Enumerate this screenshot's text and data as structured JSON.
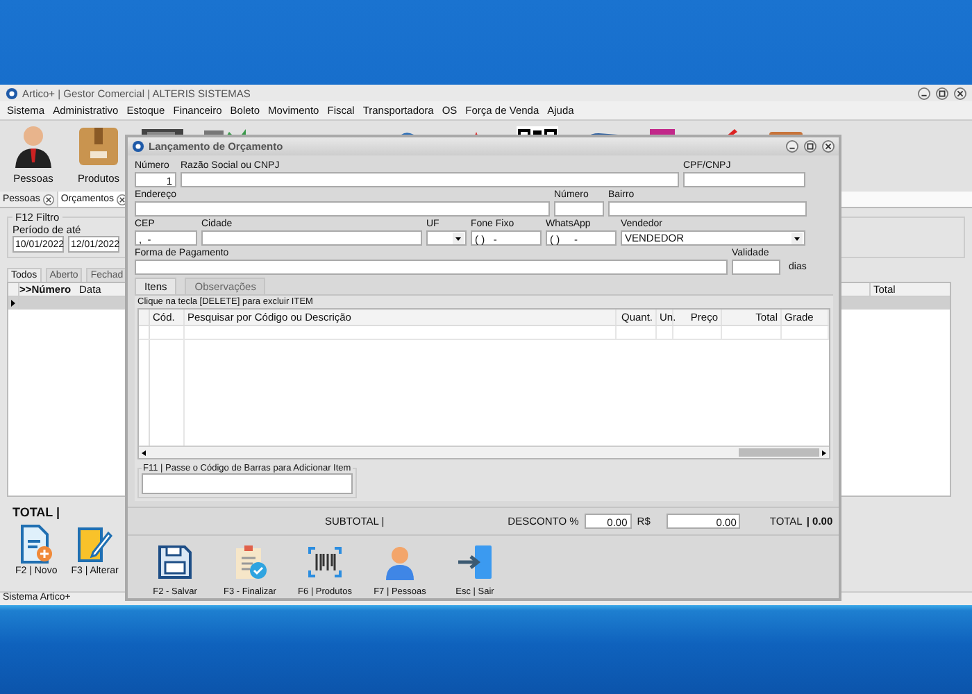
{
  "window": {
    "title": "Artico+ | Gestor Comercial | ALTERIS SISTEMAS"
  },
  "menu": [
    "Sistema",
    "Administrativo",
    "Estoque",
    "Financeiro",
    "Boleto",
    "Movimento",
    "Fiscal",
    "Transportadora",
    "OS",
    "Força de Venda",
    "Ajuda"
  ],
  "toolbar": [
    {
      "label": "Pessoas",
      "kind": "person"
    },
    {
      "label": "Produtos",
      "kind": "box"
    }
  ],
  "doc_tabs": [
    {
      "label": "Pessoas",
      "selected": false
    },
    {
      "label": "Orçamentos",
      "selected": true
    }
  ],
  "filter": {
    "title": "F12 Filtro",
    "period_label": "Período de  até",
    "from": "10/01/2022",
    "to": "12/01/2022"
  },
  "status_tabs": [
    {
      "label": "Todos",
      "selected": true
    },
    {
      "label": "Aberto",
      "selected": false
    },
    {
      "label": "Fechad",
      "selected": false
    }
  ],
  "grid": {
    "columns": [
      ">>Número",
      "Data",
      "Total"
    ]
  },
  "total_label": "TOTAL |",
  "actions": [
    {
      "label": "F2 | Novo",
      "kind": "new"
    },
    {
      "label": "F3 | Alterar",
      "kind": "edit"
    }
  ],
  "status_bar": "Sistema Artico+",
  "dialog": {
    "title": "Lançamento de Orçamento",
    "form_rows": [
      [
        {
          "label": "Número",
          "value": "1",
          "kind": "number"
        },
        {
          "label": "Razão Social ou CNPJ",
          "kind": "text"
        },
        {
          "label": "CPF/CNPJ",
          "kind": "text"
        }
      ],
      [
        {
          "label": "Endereço",
          "kind": "text"
        },
        {
          "label": "Número",
          "kind": "text"
        },
        {
          "label": "Bairro",
          "kind": "text"
        }
      ],
      [
        {
          "label": "CEP",
          "value": ",  -",
          "kind": "text"
        },
        {
          "label": "Cidade",
          "kind": "text"
        },
        {
          "label": "UF",
          "kind": "combo"
        },
        {
          "label": "Fone Fixo",
          "value": "( )   -",
          "kind": "text"
        },
        {
          "label": "WhatsApp",
          "value": "( )     -",
          "kind": "text"
        },
        {
          "label": "Vendedor",
          "value": "VENDEDOR",
          "kind": "combo"
        }
      ],
      [
        {
          "label": "Forma de Pagamento",
          "kind": "text"
        },
        {
          "label": "Validade",
          "kind": "text",
          "suffix": "dias"
        }
      ]
    ],
    "tabs": [
      {
        "label": "Itens",
        "selected": true
      },
      {
        "label": "Observações",
        "selected": false
      }
    ],
    "hint": "Clique na tecla [DELETE] para excluir ITEM",
    "columns": [
      "Cód.",
      "Pesquisar por Código ou Descrição",
      "Quant.",
      "Un.",
      "Preço",
      "Total",
      "Grade"
    ],
    "barcode_label": "F11 | Passe o Código de Barras para Adicionar Item",
    "subtotal_label": "SUBTOTAL |",
    "discount_label": "DESCONTO %",
    "discount_pct": "0.00",
    "currency_label": "R$",
    "discount_value": "0.00",
    "total_label": "TOTAL",
    "total_value": "| 0.00",
    "actions": [
      {
        "label": "F2 - Salvar",
        "kind": "save"
      },
      {
        "label": "F3 - Finalizar",
        "kind": "finish"
      },
      {
        "label": "F6 | Produtos",
        "kind": "barcode"
      },
      {
        "label": "F7 | Pessoas",
        "kind": "person"
      },
      {
        "label": "Esc | Sair",
        "kind": "exit"
      }
    ]
  }
}
